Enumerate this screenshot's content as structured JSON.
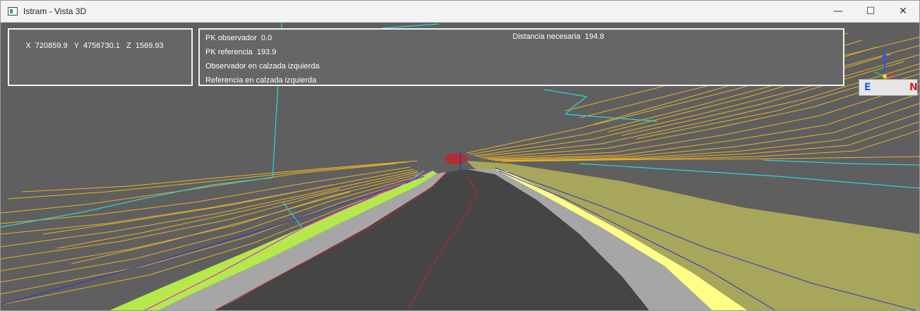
{
  "window": {
    "title": "Istram - Vista 3D",
    "minimize_glyph": "—",
    "maximize_glyph": "☐",
    "close_glyph": "✕"
  },
  "coords": {
    "text": "X  720859.9   Y  4756730.1   Z  1569.93"
  },
  "info": {
    "pk_observador": "PK observador  0.0",
    "pk_referencia": "PK referencia  193.9",
    "observador": "Observador en calzada izquierda",
    "referencia": "Referencia en calzada izquierda",
    "distancia": "Distancia necesaria  194.8"
  },
  "compass": {
    "east": "E",
    "north": "N"
  },
  "colors": {
    "road": "#454545",
    "shoulder": "#a6a6a6",
    "yellow_line": "#ffff88",
    "embankment": "#a8a65a",
    "contour": "#e6b02a",
    "cyan": "#2fd3d6",
    "blue": "#3333cc",
    "red": "#cc2222",
    "green": "#b5e84a",
    "magenta": "#e020e0"
  }
}
